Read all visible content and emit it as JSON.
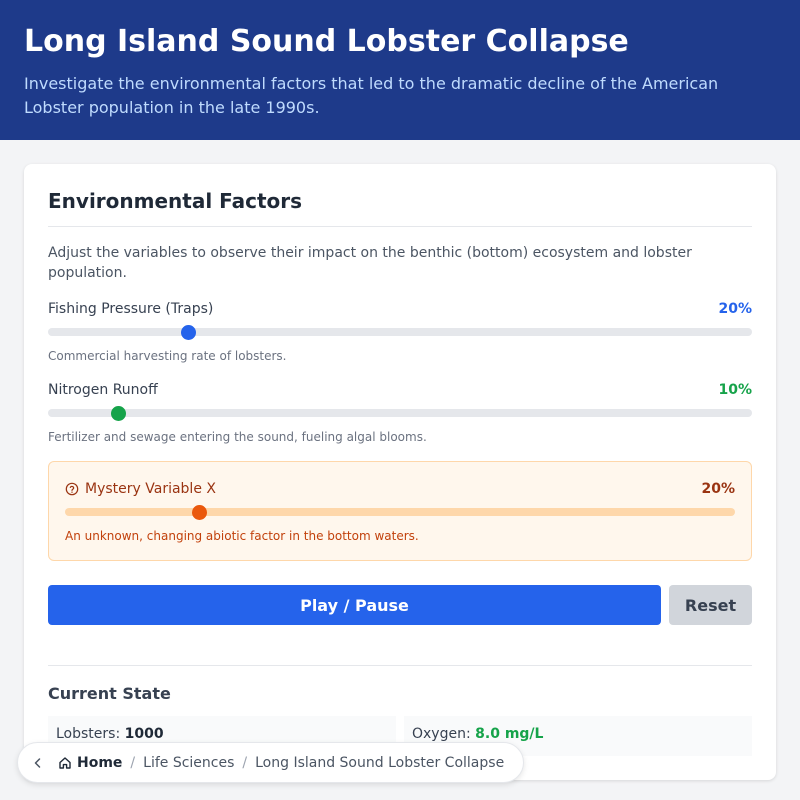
{
  "header": {
    "title": "Long Island Sound Lobster Collapse",
    "subtitle": "Investigate the environmental factors that led to the dramatic decline of the American Lobster population in the late 1990s."
  },
  "panel": {
    "title": "Environmental Factors",
    "intro": "Adjust the variables to observe their impact on the benthic (bottom) ecosystem and lobster population."
  },
  "factors": {
    "fishing": {
      "label": "Fishing Pressure (Traps)",
      "value_text": "20%",
      "value": 20,
      "description": "Commercial harvesting rate of lobsters.",
      "color": "#2563eb"
    },
    "nitrogen": {
      "label": "Nitrogen Runoff",
      "value_text": "10%",
      "value": 10,
      "description": "Fertilizer and sewage entering the sound, fueling algal blooms.",
      "color": "#16a34a"
    },
    "mystery": {
      "icon": "help-circle-icon",
      "label": "Mystery Variable X",
      "value_text": "20%",
      "value": 20,
      "description": "An unknown, changing abiotic factor in the bottom waters.",
      "color": "#ea580c"
    }
  },
  "controls": {
    "play_label": "Play / Pause",
    "reset_label": "Reset"
  },
  "state": {
    "title": "Current State",
    "lobsters_label": "Lobsters:",
    "lobsters_value": "1000",
    "oxygen_label": "Oxygen:",
    "oxygen_value": "8.0 mg/L"
  },
  "breadcrumb": {
    "back_icon": "chevron-left-icon",
    "home_icon": "home-icon",
    "home": "Home",
    "section": "Life Sciences",
    "current": "Long Island Sound Lobster Collapse",
    "separator": "/"
  }
}
